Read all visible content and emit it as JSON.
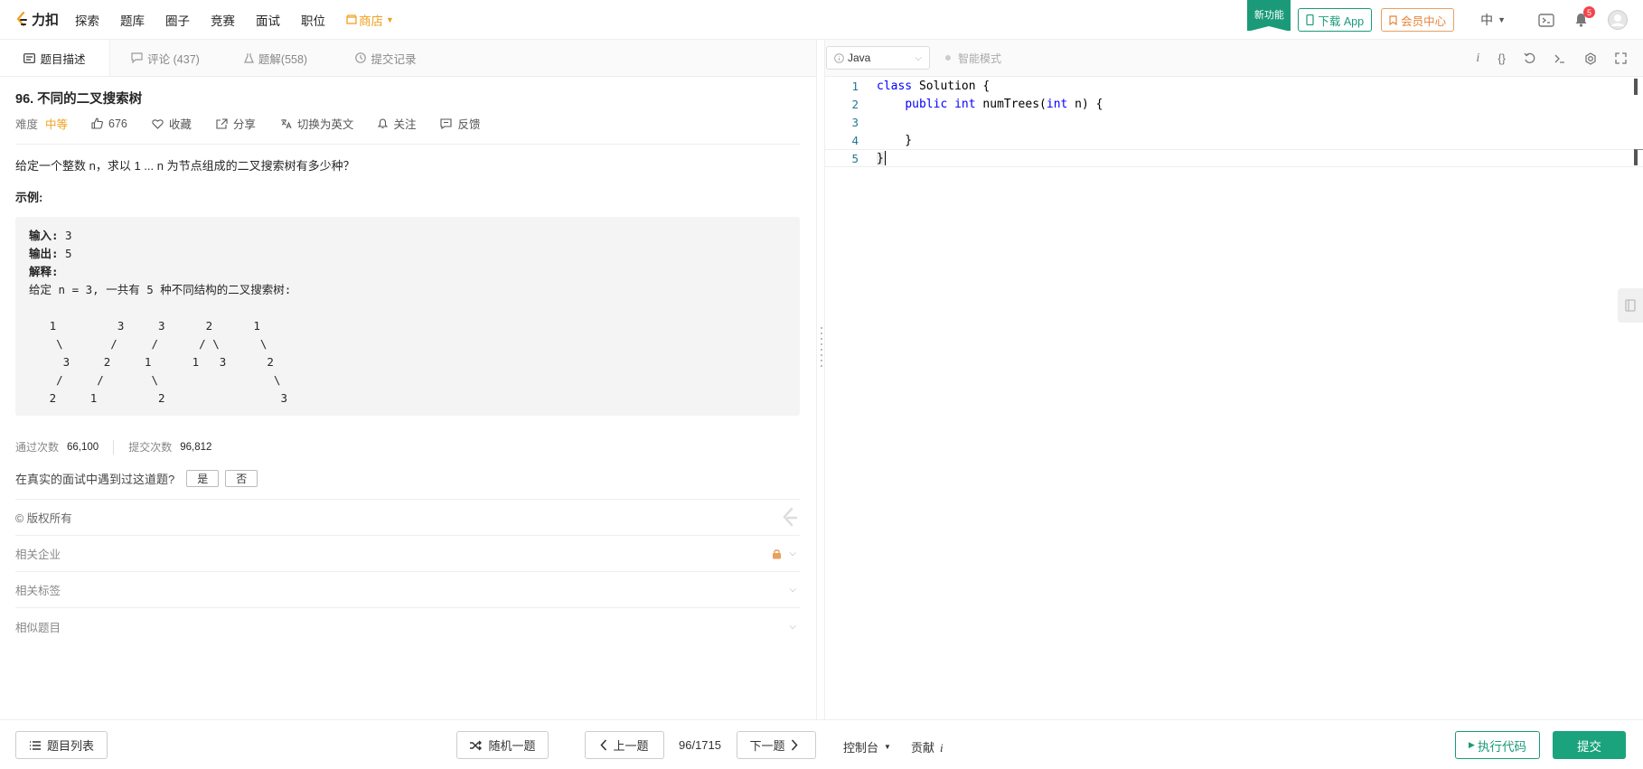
{
  "topbar": {
    "logo_text": "力扣",
    "nav": [
      "探索",
      "题库",
      "圈子",
      "竞赛",
      "面试",
      "职位"
    ],
    "store_label": "商店",
    "new_feature_label": "新功能",
    "download_app_label": "下载 App",
    "vip_label": "会员中心",
    "language": "中",
    "notification_count": "5",
    "accent_color": "#1a9a78",
    "store_color": "#f0a020"
  },
  "left": {
    "tabs": [
      {
        "label": "题目描述"
      },
      {
        "label": "评论 (437)"
      },
      {
        "label": "题解(558)"
      },
      {
        "label": "提交记录"
      }
    ],
    "problem": {
      "title": "96. 不同的二叉搜索树",
      "difficulty_label": "难度",
      "difficulty": "中等",
      "likes": "676",
      "favorite_label": "收藏",
      "share_label": "分享",
      "switch_lang_label": "切换为英文",
      "follow_label": "关注",
      "feedback_label": "反馈",
      "description": "给定一个整数 n，求以 1 ... n 为节点组成的二叉搜索树有多少种？",
      "example_title": "示例:",
      "example_input_label": "输入:",
      "example_input": " 3",
      "example_output_label": "输出:",
      "example_output": " 5",
      "example_explain_label": "解释:",
      "example_explain": "给定 n = 3, 一共有 5 种不同结构的二叉搜索树:",
      "example_trees": "\n   1         3     3      2      1\n    \\       /     /      / \\      \\\n     3     2     1      1   3      2\n    /     /       \\                 \\\n   2     1         2                 3"
    },
    "stats": {
      "accepted_label": "通过次数",
      "accepted": "66,100",
      "submissions_label": "提交次数",
      "submissions": "96,812"
    },
    "interview": {
      "question": "在真实的面试中遇到过这道题?",
      "yes": "是",
      "no": "否"
    },
    "copyright": "© 版权所有",
    "sections": [
      "相关企业",
      "相关标签",
      "相似题目"
    ]
  },
  "editor": {
    "language": "Java",
    "smart_mode_label": "智能模式",
    "lines": [
      {
        "no": "1"
      },
      {
        "no": "2"
      },
      {
        "no": "3"
      },
      {
        "no": "4"
      },
      {
        "no": "5"
      }
    ],
    "code": {
      "l1_kw": "class",
      "l1_rest": " Solution {",
      "l2_indent": "    ",
      "l2_kw1": "public",
      "l2_kw2": "int",
      "l2_mid": " numTrees(",
      "l2_kw3": "int",
      "l2_end": " n) {",
      "l4": "    }",
      "l5": "}"
    }
  },
  "bottom": {
    "problem_list": "题目列表",
    "random": "随机一题",
    "prev": "上一题",
    "page_info": "96/1715",
    "next": "下一题",
    "console": "控制台",
    "contribute": "贡献",
    "contribute_icon": "i",
    "run": "执行代码",
    "submit": "提交"
  }
}
